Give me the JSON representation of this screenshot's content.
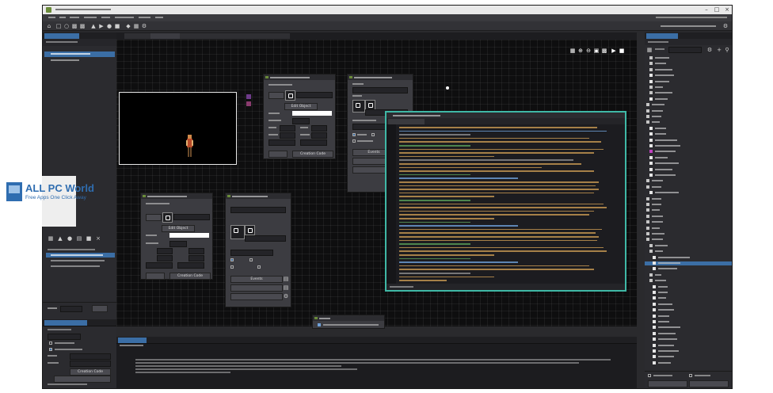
{
  "watermark": {
    "text": "ALL PC World",
    "tagline": "Free Apps One Click Away"
  },
  "colors": {
    "accent_tab": "#3b6ea5",
    "code_border": "#3fb8a6",
    "workspace_bg": "#0e0e0f",
    "titlebar_bg": "#e9e9e9"
  },
  "windows": {
    "edit_object_button": "Edit Object",
    "creation_code_button": "Creation Code",
    "events_button": "Events"
  },
  "icons": [
    "app-icon",
    "minimize-icon",
    "maximize-icon",
    "close-icon",
    "new-icon",
    "open-icon",
    "save-icon",
    "play-icon",
    "debug-icon",
    "stop-icon",
    "settings-icon",
    "zoom-icon",
    "grid-icon",
    "sprite-icon",
    "object-icon",
    "folder-icon",
    "search-icon"
  ]
}
